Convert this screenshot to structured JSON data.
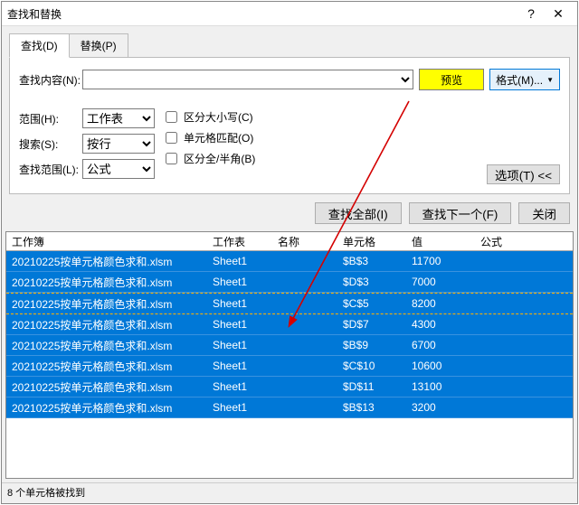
{
  "window": {
    "title": "查找和替换",
    "help_icon": "?",
    "close_icon": "✕"
  },
  "tabs": {
    "find": "查找(D)",
    "replace": "替换(P)"
  },
  "labels": {
    "findwhat": "查找内容(N):",
    "within": "范围(H):",
    "search": "搜索(S):",
    "lookin": "查找范围(L):"
  },
  "dropdowns": {
    "within": "工作表",
    "search": "按行",
    "lookin": "公式"
  },
  "checks": {
    "matchcase": "区分大小写(C)",
    "entire": "单元格匹配(O)",
    "halfwidth": "区分全/半角(B)"
  },
  "preview": "预览",
  "format": "格式(M)...",
  "options": "选项(T) <<",
  "buttons": {
    "findall": "查找全部(I)",
    "findnext": "查找下一个(F)",
    "close": "关闭"
  },
  "headers": {
    "workbook": "工作簿",
    "sheet": "工作表",
    "name": "名称",
    "cell": "单元格",
    "value": "值",
    "formula": "公式"
  },
  "rows": [
    {
      "wb": "20210225按单元格颜色求和.xlsm",
      "sheet": "Sheet1",
      "name": "",
      "cell": "$B$3",
      "value": "11700",
      "formula": ""
    },
    {
      "wb": "20210225按单元格颜色求和.xlsm",
      "sheet": "Sheet1",
      "name": "",
      "cell": "$D$3",
      "value": "7000",
      "formula": ""
    },
    {
      "wb": "20210225按单元格颜色求和.xlsm",
      "sheet": "Sheet1",
      "name": "",
      "cell": "$C$5",
      "value": "8200",
      "formula": ""
    },
    {
      "wb": "20210225按单元格颜色求和.xlsm",
      "sheet": "Sheet1",
      "name": "",
      "cell": "$D$7",
      "value": "4300",
      "formula": ""
    },
    {
      "wb": "20210225按单元格颜色求和.xlsm",
      "sheet": "Sheet1",
      "name": "",
      "cell": "$B$9",
      "value": "6700",
      "formula": ""
    },
    {
      "wb": "20210225按单元格颜色求和.xlsm",
      "sheet": "Sheet1",
      "name": "",
      "cell": "$C$10",
      "value": "10600",
      "formula": ""
    },
    {
      "wb": "20210225按单元格颜色求和.xlsm",
      "sheet": "Sheet1",
      "name": "",
      "cell": "$D$11",
      "value": "13100",
      "formula": ""
    },
    {
      "wb": "20210225按单元格颜色求和.xlsm",
      "sheet": "Sheet1",
      "name": "",
      "cell": "$B$13",
      "value": "3200",
      "formula": ""
    }
  ],
  "status": "8 个单元格被找到",
  "highlight_row_index": 2
}
